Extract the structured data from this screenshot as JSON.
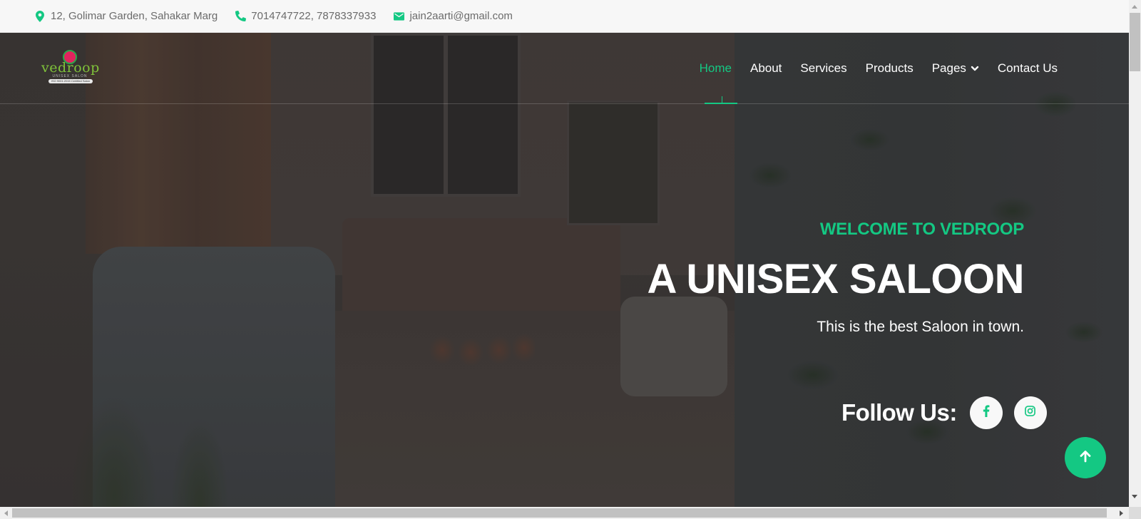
{
  "topbar": {
    "address": "12, Golimar Garden, Sahakar Marg",
    "phone": "7014747722, 7878337933",
    "email": "jain2aarti@gmail.com",
    "icons": {
      "address": "map-marker-icon",
      "phone": "phone-icon",
      "email": "envelope-icon"
    }
  },
  "brand": {
    "name": "vedroop",
    "subtitle": "UNISEX SALON",
    "tagline": "ISO 9001:2015 Certified Salon"
  },
  "nav": {
    "items": [
      {
        "label": "Home",
        "active": true
      },
      {
        "label": "About",
        "active": false
      },
      {
        "label": "Services",
        "active": false
      },
      {
        "label": "Products",
        "active": false
      },
      {
        "label": "Pages",
        "active": false,
        "dropdown": true
      },
      {
        "label": "Contact Us",
        "active": false
      }
    ]
  },
  "hero": {
    "kicker": "WELCOME TO VEDROOP",
    "title": "A UNISEX SALOON",
    "subtitle": "This is the best Saloon in town.",
    "follow_label": "Follow Us:",
    "socials": [
      {
        "name": "facebook",
        "icon": "facebook-icon"
      },
      {
        "name": "instagram",
        "icon": "instagram-icon"
      }
    ]
  },
  "colors": {
    "accent": "#14c883",
    "topbar_bg": "#f7f7f7",
    "topbar_text": "#6b6b6b",
    "text_light": "#ffffff"
  },
  "back_to_top": {
    "icon": "arrow-up-icon"
  }
}
